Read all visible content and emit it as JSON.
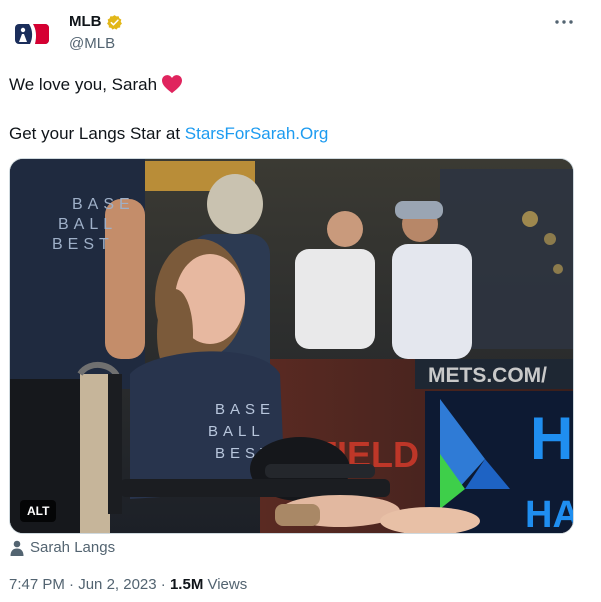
{
  "author": {
    "name": "MLB",
    "handle": "@MLB"
  },
  "tweet": {
    "line1": "We love you, Sarah",
    "line2_prefix": "Get your Langs Star at ",
    "line2_link": "StarsForSarah.Org"
  },
  "media": {
    "alt_label": "ALT",
    "shirt_text": [
      "BASE",
      "BALL",
      "BEST"
    ],
    "sign_text": "METS.COM/",
    "field_text": "FIELD",
    "edge_text_1": "H",
    "edge_text_2": "HA"
  },
  "tagged": {
    "name": "Sarah Langs"
  },
  "meta": {
    "time": "7:47 PM",
    "sep1": " · ",
    "date": "Jun 2, 2023",
    "sep2": " · ",
    "views_count": "1.5M",
    "views_label": " Views"
  },
  "colors": {
    "link": "#1d9bf0",
    "secondary_text": "#536471",
    "heart": "#f91880",
    "verified": "#e2b719"
  }
}
